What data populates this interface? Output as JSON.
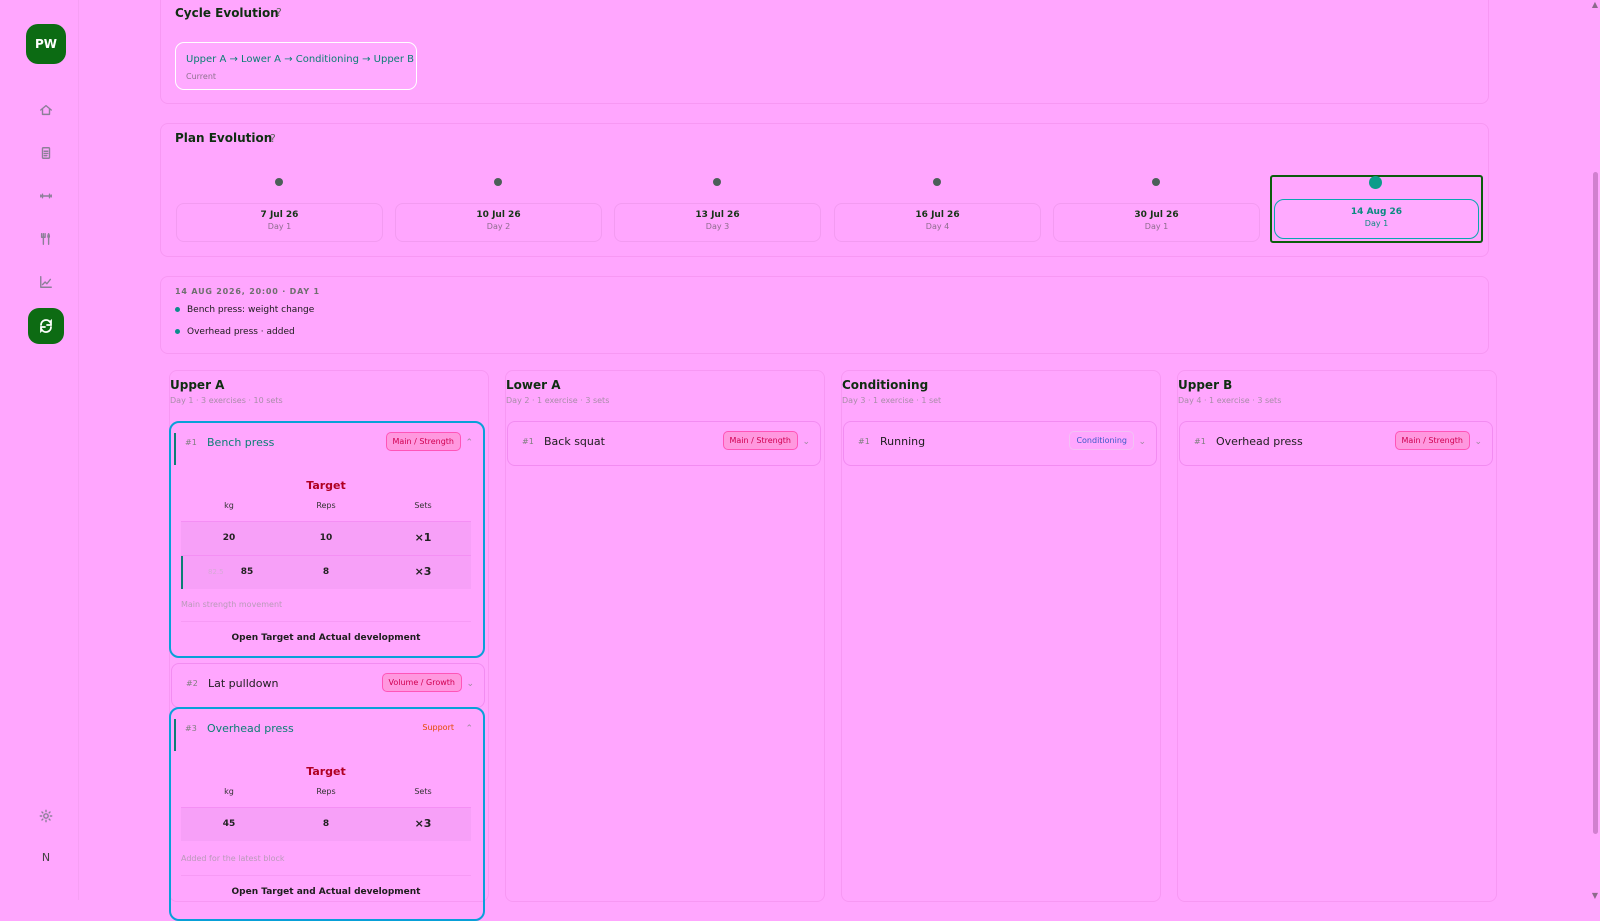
{
  "app": {
    "logo_initials": "PW",
    "user_initial": "N",
    "accent_color": "#0c6b13",
    "nav_icons": [
      "home-icon",
      "document-icon",
      "dumbbell-icon",
      "utensils-icon",
      "chart-icon",
      "cycle-icon",
      "settings-icon"
    ]
  },
  "cycle": {
    "title": "Cycle Evolution",
    "help": "?",
    "current_path": "Upper A → Lower A → Conditioning → Upper B",
    "current_label": "Current"
  },
  "plan": {
    "title": "Plan Evolution",
    "help": "?",
    "timeline": [
      {
        "date": "7 Jul 26",
        "day": "Day 1"
      },
      {
        "date": "10 Jul 26",
        "day": "Day 2"
      },
      {
        "date": "13 Jul 26",
        "day": "Day 3"
      },
      {
        "date": "16 Jul 26",
        "day": "Day 4"
      },
      {
        "date": "30 Jul 26",
        "day": "Day 1"
      },
      {
        "date": "14 Aug 26",
        "day": "Day 1"
      }
    ]
  },
  "changes": {
    "heading": "14 AUG 2026, 20:00 · DAY 1",
    "items": [
      "Bench press: weight change",
      "Overhead press · added"
    ]
  },
  "days": [
    {
      "title": "Upper A",
      "meta": "Day 1 · 3 exercises · 10 sets",
      "exercises": [
        {
          "number": "#1",
          "name": "Bench press",
          "tag": "Main / Strength",
          "chevron": "⌃",
          "target_title": "Target",
          "headers": [
            "kg",
            "Reps",
            "Sets"
          ],
          "rows": [
            {
              "kg": "20",
              "reps": "10",
              "sets": "×1"
            },
            {
              "previous": "82.5",
              "kg": "85",
              "reps": "8",
              "sets": "×3"
            }
          ],
          "note": "Main strength movement",
          "link": "Open Target and Actual development"
        },
        {
          "number": "#2",
          "name": "Lat pulldown",
          "tag": "Volume / Growth",
          "chevron": "⌄"
        },
        {
          "number": "#3",
          "name": "Overhead press",
          "tag": "Support",
          "chevron": "⌃",
          "target_title": "Target",
          "headers": [
            "kg",
            "Reps",
            "Sets"
          ],
          "rows": [
            {
              "kg": "45",
              "reps": "8",
              "sets": "×3"
            }
          ],
          "note": "Added for the latest block",
          "link": "Open Target and Actual development"
        }
      ]
    },
    {
      "title": "Lower A",
      "meta": "Day 2 · 1 exercise · 3 sets",
      "exercises": [
        {
          "number": "#1",
          "name": "Back squat",
          "tag": "Main / Strength",
          "chevron": "⌄"
        }
      ]
    },
    {
      "title": "Conditioning",
      "meta": "Day 3 · 1 exercise · 1 set",
      "exercises": [
        {
          "number": "#1",
          "name": "Running",
          "tag": "Conditioning",
          "chevron": "⌄"
        }
      ]
    },
    {
      "title": "Upper B",
      "meta": "Day 4 · 1 exercise · 3 sets",
      "exercises": [
        {
          "number": "#1",
          "name": "Overhead press",
          "tag": "Main / Strength",
          "chevron": "⌄"
        }
      ]
    }
  ]
}
